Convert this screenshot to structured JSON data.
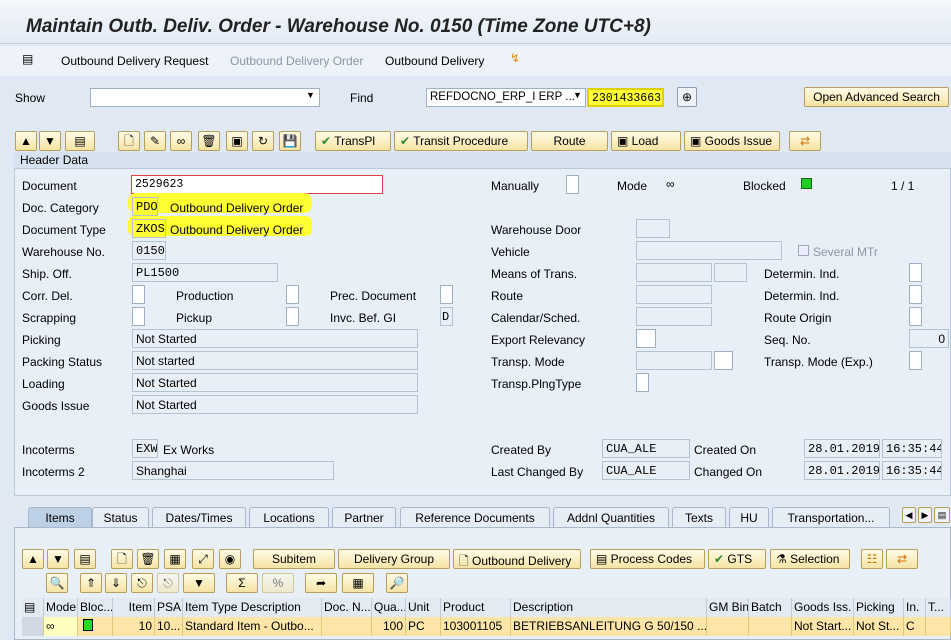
{
  "title": "Maintain Outb. Deliv. Order - Warehouse No. 0150 (Time Zone UTC+8)",
  "menu": {
    "request": "Outbound Delivery Request",
    "order": "Outbound Delivery Order",
    "delivery": "Outbound Delivery"
  },
  "search": {
    "show_label": "Show",
    "show_value": "",
    "find_label": "Find",
    "find_field": "REFDOCNO_ERP_I ERP ...",
    "find_value": "2301433663",
    "advanced": "Open Advanced Search"
  },
  "toolbar": {
    "transpl": "TransPl",
    "transit": "Transit Procedure",
    "route": "Route",
    "load": "Load",
    "goods_issue": "Goods Issue"
  },
  "header": {
    "title": "Header Data",
    "pager": "1 / 1",
    "labels": {
      "document": "Document",
      "doc_category": "Doc. Category",
      "doc_type": "Document Type",
      "warehouse": "Warehouse No.",
      "ship_off": "Ship. Off.",
      "corr_del": "Corr. Del.",
      "production": "Production",
      "prec_doc": "Prec. Document",
      "scrapping": "Scrapping",
      "pickup": "Pickup",
      "invc": "Invc. Bef. GI",
      "picking": "Picking",
      "packing": "Packing Status",
      "loading": "Loading",
      "goods_issue": "Goods Issue",
      "incoterms": "Incoterms",
      "incoterms2": "Incoterms 2",
      "manually": "Manually",
      "mode": "Mode",
      "blocked": "Blocked",
      "wh_door": "Warehouse Door",
      "vehicle": "Vehicle",
      "several": "Several MTr",
      "means": "Means of Trans.",
      "determ1": "Determin. Ind.",
      "route": "Route",
      "determ2": "Determin. Ind.",
      "calendar": "Calendar/Sched.",
      "route_origin": "Route Origin",
      "export": "Export Relevancy",
      "seq": "Seq. No.",
      "transp_mode": "Transp. Mode",
      "transp_mode_exp": "Transp. Mode (Exp.)",
      "transp_plng": "Transp.PlngType",
      "created_by": "Created By",
      "created_on": "Created On",
      "changed_by": "Last Changed By",
      "changed_on": "Changed On"
    },
    "values": {
      "document": "2529623",
      "doc_category": "PDO",
      "doc_category_text": "Outbound Delivery Order",
      "doc_type": "ZKOS",
      "doc_type_text": "Outbound Delivery Order",
      "warehouse": "0150",
      "ship_off": "PL1500",
      "invc": "D",
      "picking": "Not Started",
      "packing": "Not started",
      "loading": "Not Started",
      "goods_issue": "Not Started",
      "incoterms": "EXW",
      "incoterms_text": "Ex Works",
      "incoterms2": "Shanghai",
      "seq": "0",
      "created_by": "CUA_ALE",
      "created_date": "28.01.2019",
      "created_time": "16:35:44",
      "changed_by": "CUA_ALE",
      "changed_date": "28.01.2019",
      "changed_time": "16:35:44"
    }
  },
  "tabs": [
    "Items",
    "Status",
    "Dates/Times",
    "Locations",
    "Partner",
    "Reference Documents",
    "Addnl Quantities",
    "Texts",
    "HU",
    "Transportation..."
  ],
  "items_toolbar": {
    "subitem": "Subitem",
    "group": "Delivery Group",
    "outbound": "Outbound Delivery",
    "process": "Process Codes",
    "gts": "GTS",
    "selection": "Selection"
  },
  "table": {
    "columns": [
      "Mode",
      "Bloc...",
      "Item",
      "PSA",
      "Item Type Description",
      "Doc. N...",
      "Qua...",
      "Unit",
      "Product",
      "Description",
      "GM Bin",
      "Batch",
      "Goods Iss.",
      "Picking",
      "In.",
      "T..."
    ],
    "rows": [
      [
        "",
        "",
        "10",
        "10...",
        "Standard Item - Outbo...",
        "",
        "100",
        "PC",
        "103001105",
        "BETRIEBSANLEITUNG G 50/150 ...",
        "",
        "",
        "Not Start...",
        "Not St...",
        "C",
        ""
      ]
    ]
  },
  "colors": {
    "highlight": "#ffff33",
    "status_green": "#22cc22",
    "button": "#f6e3a4"
  }
}
